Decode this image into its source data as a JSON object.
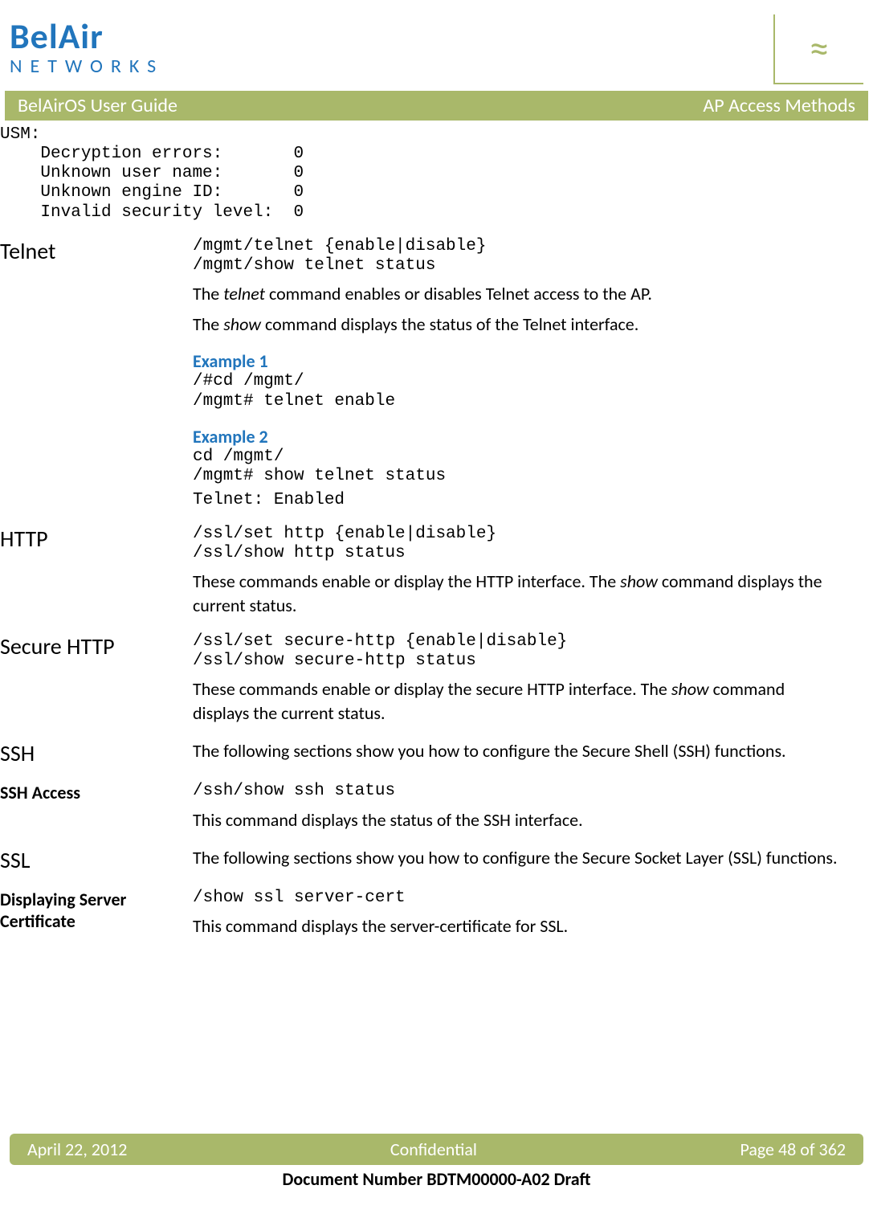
{
  "logo": {
    "name": "BelAir",
    "subtitle": "NETWORKS"
  },
  "bar": {
    "left": "BelAirOS User Guide",
    "right": "AP Access Methods"
  },
  "usm": "USM:\n    Decryption errors:       0\n    Unknown user name:       0\n    Unknown engine ID:       0\n    Invalid security level:  0",
  "telnet": {
    "heading": "Telnet",
    "cmd": "/mgmt/telnet {enable|disable}\n/mgmt/show telnet status",
    "p1a": "The ",
    "p1b": "telnet",
    "p1c": " command enables or disables Telnet access to the AP.",
    "p2a": "The ",
    "p2b": "show",
    "p2c": " command displays the status of the Telnet interface.",
    "ex1h": "Example 1",
    "ex1": "/#cd /mgmt/\n/mgmt# telnet enable",
    "ex2h": "Example 2",
    "ex2": "cd /mgmt/\n/mgmt# show telnet status",
    "ex2out": "Telnet: Enabled"
  },
  "http": {
    "heading": "HTTP",
    "cmd": "/ssl/set http {enable|disable}\n/ssl/show http status",
    "p1a": "These commands enable or display the HTTP interface. The ",
    "p1b": "show",
    "p1c": " command displays the current status."
  },
  "shttp": {
    "heading": "Secure HTTP",
    "cmd": "/ssl/set secure-http {enable|disable}\n/ssl/show secure-http status",
    "p1a": "These commands enable or display the secure HTTP interface. The ",
    "p1b": "show",
    "p1c": " command displays the current status."
  },
  "ssh": {
    "heading": "SSH",
    "p1": "The following sections show you how to configure the Secure Shell (SSH) functions."
  },
  "sshaccess": {
    "heading": "SSH Access",
    "cmd": "/ssh/show ssh status",
    "p1": "This command displays the status of the SSH interface."
  },
  "ssl": {
    "heading": "SSL",
    "p1": "The following sections show you how to configure the Secure Socket Layer (SSL) functions."
  },
  "cert": {
    "heading": "Displaying Server Certificate",
    "cmd": "/show ssl server-cert",
    "p1": "This command displays the server-certificate for SSL."
  },
  "footer": {
    "date": "April 22, 2012",
    "center": "Confidential",
    "page": "Page 48 of 362",
    "docline": "Document Number BDTM00000-A02 Draft"
  }
}
